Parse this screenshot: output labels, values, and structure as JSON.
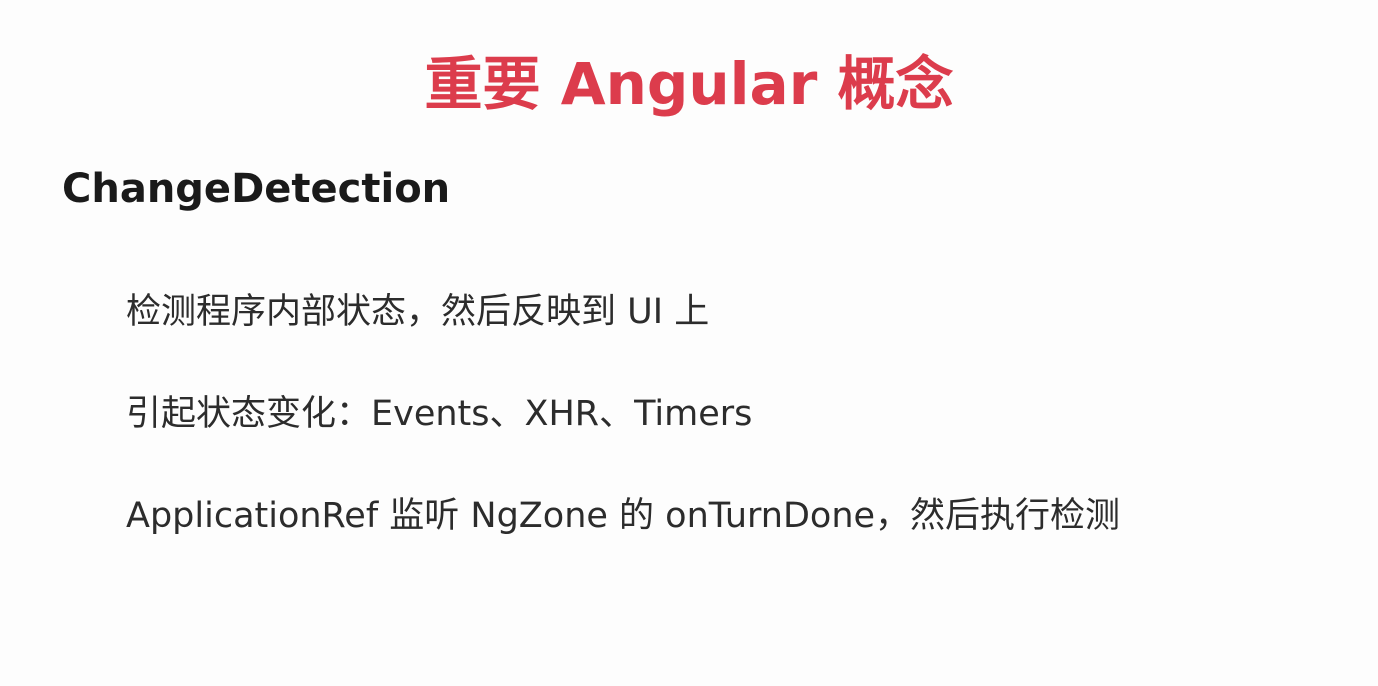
{
  "slide": {
    "title": "重要 Angular 概念",
    "subtitle": "ChangeDetection",
    "points": [
      "检测程序内部状态，然后反映到 UI 上",
      "引起状态变化：Events、XHR、Timers",
      "ApplicationRef 监听 NgZone 的 onTurnDone，然后执行检测"
    ]
  },
  "colors": {
    "title": "#dc3c4c",
    "text": "#2c2c2c",
    "background": "#fdfdfd"
  }
}
